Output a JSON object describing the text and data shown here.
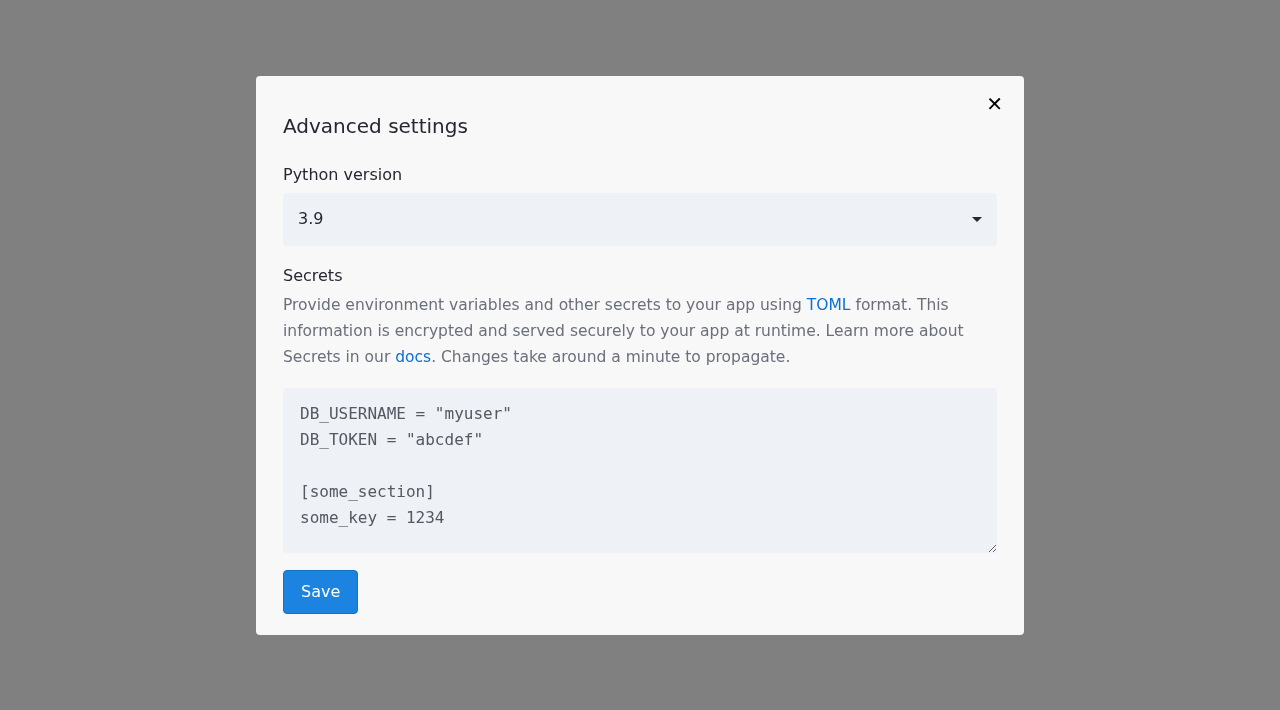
{
  "dialog": {
    "title": "Advanced settings",
    "close_label": "✕",
    "python_version": {
      "label": "Python version",
      "value": "3.9"
    },
    "secrets": {
      "label": "Secrets",
      "description": [
        {
          "kind": "text",
          "text": "Provide environment variables and other secrets to your app using "
        },
        {
          "kind": "link",
          "text": "TOML"
        },
        {
          "kind": "text",
          "text": " format. This information is encrypted and served securely to your app at runtime. Learn more about Secrets in our "
        },
        {
          "kind": "link",
          "text": "docs"
        },
        {
          "kind": "text",
          "text": ". Changes take around a minute to propagate."
        }
      ],
      "value": "DB_USERNAME = \"myuser\"\nDB_TOKEN = \"abcdef\"\n\n[some_section]\nsome_key = 1234"
    },
    "save_button": "Save"
  }
}
